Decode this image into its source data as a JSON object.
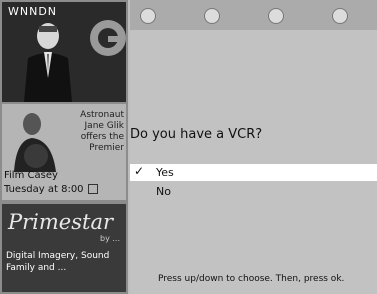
{
  "channel_label": "WNNDN",
  "promo": {
    "ad_text": "Astronaut Jane Glik offers the Premier",
    "show": "Film Casey",
    "when": "Tuesday at 8:00"
  },
  "brand": {
    "name": "Primestar",
    "sub": "by ...",
    "tagline": "Digital Imagery, Sound Family and ..."
  },
  "tabs": [
    "tab-1",
    "tab-2",
    "tab-3",
    "tab-4"
  ],
  "question": "Do you have a VCR?",
  "options": [
    {
      "label": "Yes",
      "selected": true,
      "check": "✓"
    },
    {
      "label": "No",
      "selected": false
    }
  ],
  "footer": "Press up/down to choose. Then, press ok."
}
